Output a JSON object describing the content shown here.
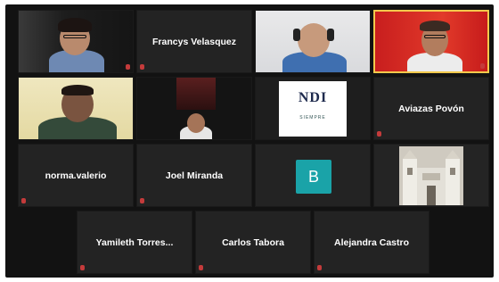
{
  "participants": [
    {
      "name": "",
      "video": true
    },
    {
      "name": "Francys Velasquez",
      "video": false
    },
    {
      "name": "",
      "video": true
    },
    {
      "name": "",
      "video": true
    },
    {
      "name": "",
      "video": true
    },
    {
      "name": "",
      "video": true
    },
    {
      "name": "",
      "video": true
    },
    {
      "name": "Aviazas Povón",
      "video": false
    },
    {
      "name": "norma.valerio",
      "video": false
    },
    {
      "name": "Joel Miranda",
      "video": false
    },
    {
      "name": "",
      "video": false,
      "avatar_letter": "B",
      "avatar_color": "#1aa3a8"
    },
    {
      "name": "",
      "video": true
    },
    {
      "name": "Yamileth Torres...",
      "video": false
    },
    {
      "name": "Carlos Tabora",
      "video": false
    },
    {
      "name": "Alejandra Castro",
      "video": false
    }
  ],
  "ndi_card": {
    "logo": "NDI",
    "subtitle": "SIEMPRE"
  },
  "colors": {
    "active_speaker_border": "#f2c94c",
    "muted_mic": "#c43b3b",
    "background": "#121212"
  }
}
